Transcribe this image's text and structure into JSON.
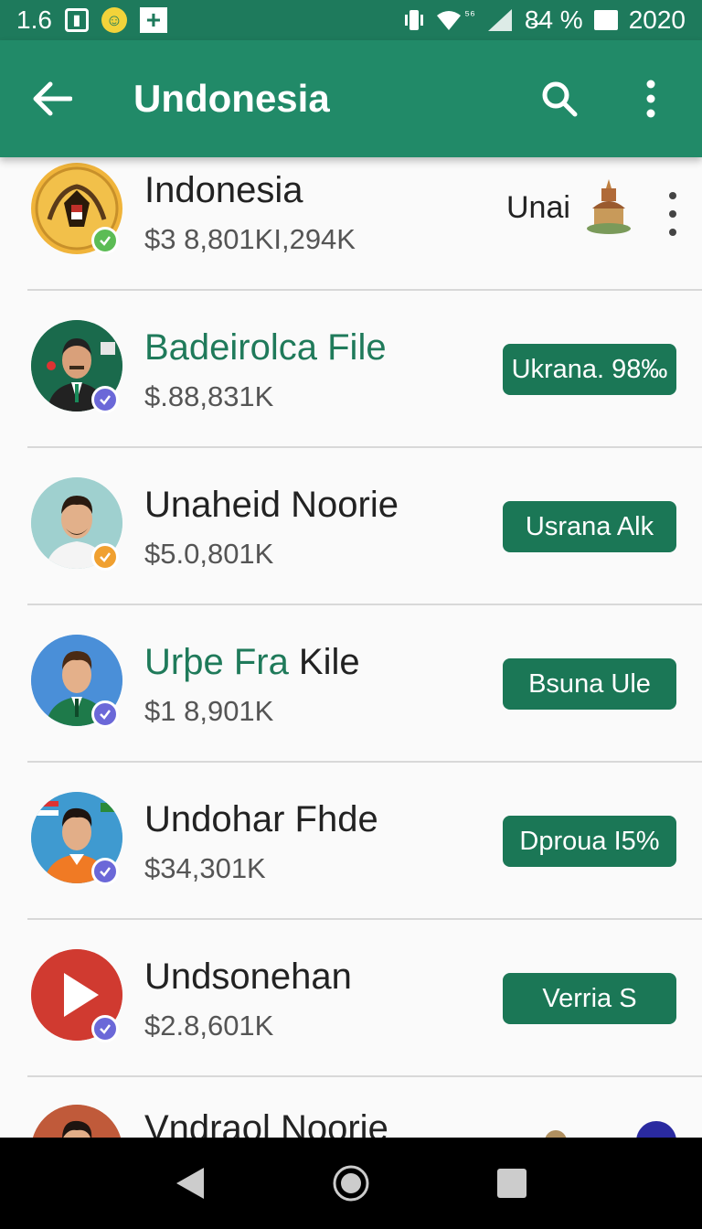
{
  "status_bar": {
    "left_text": "1.6",
    "signal_text": "⁵⁶",
    "battery_pct": "8̶4 %",
    "clock": "2020"
  },
  "app_bar": {
    "title": "Undonesia",
    "icons": [
      "back-arrow-icon",
      "search-icon",
      "more-vert-icon"
    ]
  },
  "list": {
    "first": {
      "title": "Indonesia",
      "subtitle": "$3 8,801KI,294K",
      "side_label": "Unai",
      "badge_color": "#5cbc55"
    },
    "rows": [
      {
        "title": "Badeirolca File",
        "title_green": true,
        "subtitle": "$.88,831K",
        "button": "Ukrana. 98‰",
        "badge_color": "#6b68d8",
        "avatar_bg": "#1a6a4c"
      },
      {
        "title": "Unaheid Noorie",
        "title_green": false,
        "subtitle": "$5.0,801K",
        "button": "Usrana Alk",
        "badge_color": "#f0a030",
        "avatar_bg": "#9fd0cf"
      },
      {
        "title_green_part": "Urþe Fra",
        "title_dark_part": " Kile",
        "subtitle": "$1 8,901K",
        "button": "Bsuna Ule",
        "badge_color": "#6b68d8",
        "avatar_bg": "#4a8fd8"
      },
      {
        "title": "Undohar Fhde",
        "title_green": false,
        "subtitle": "$34,301K",
        "button": "Dproua I5%",
        "badge_color": "#6b68d8",
        "avatar_bg": "#3f9ad0"
      },
      {
        "title": "Undsonehan",
        "title_green": false,
        "subtitle": "$2.8,601K",
        "button": "Verria S",
        "badge_color": "#6b68d8",
        "avatar_bg": "#d03a30"
      }
    ],
    "partial": {
      "title": "Vndraol Noorie"
    }
  },
  "nav_bar": {
    "buttons": [
      "back-triangle-icon",
      "home-circle-icon",
      "recents-square-icon"
    ]
  }
}
